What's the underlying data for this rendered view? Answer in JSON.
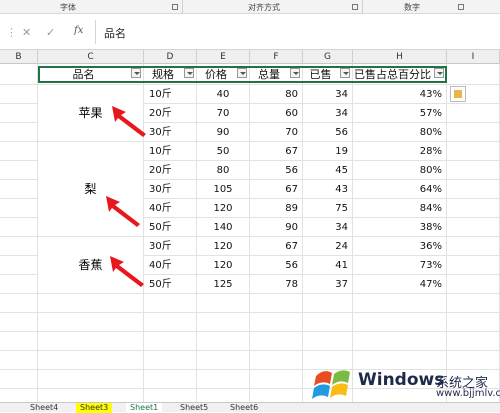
{
  "ribbon": {
    "groups": [
      "字体",
      "对齐方式",
      "数字"
    ]
  },
  "formula_bar": {
    "cancel": "✕",
    "confirm": "✓",
    "fx": "fx",
    "value": "品名"
  },
  "columns": [
    "B",
    "C",
    "D",
    "E",
    "F",
    "G",
    "H",
    "I"
  ],
  "table": {
    "headers": [
      "品名",
      "规格",
      "价格",
      "总量",
      "已售",
      "已售占总百分比"
    ],
    "groups": [
      "苹果",
      "梨",
      "香蕉"
    ],
    "rows": [
      [
        "10斤",
        "40",
        "80",
        "34",
        "43%"
      ],
      [
        "20斤",
        "70",
        "60",
        "34",
        "57%"
      ],
      [
        "30斤",
        "90",
        "70",
        "56",
        "80%"
      ],
      [
        "10斤",
        "50",
        "67",
        "19",
        "28%"
      ],
      [
        "20斤",
        "80",
        "56",
        "45",
        "80%"
      ],
      [
        "30斤",
        "105",
        "67",
        "43",
        "64%"
      ],
      [
        "40斤",
        "120",
        "89",
        "75",
        "84%"
      ],
      [
        "50斤",
        "140",
        "90",
        "34",
        "38%"
      ],
      [
        "30斤",
        "120",
        "67",
        "24",
        "36%"
      ],
      [
        "40斤",
        "120",
        "56",
        "41",
        "73%"
      ],
      [
        "50斤",
        "125",
        "78",
        "37",
        "47%"
      ]
    ]
  },
  "sheet_tabs": [
    "Sheet4",
    "Sheet3",
    "Sheet1",
    "Sheet5",
    "Sheet6"
  ],
  "watermark": {
    "brand": "Windows",
    "site_cn": "系统之家",
    "site_url": "www.bjjmlv.com"
  },
  "colors": {
    "selection": "#217346",
    "arrow": "#e8171c",
    "active_tab": "#ffff00"
  }
}
